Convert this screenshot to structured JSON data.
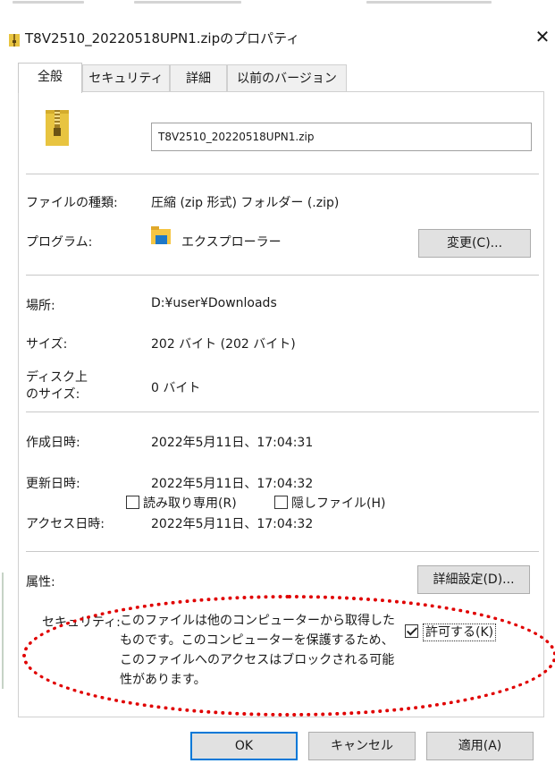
{
  "window": {
    "title": "T8V2510_20220518UPN1.zipのプロパティ",
    "close_symbol": "✕"
  },
  "tabs": [
    "全般",
    "セキュリティ",
    "詳細",
    "以前のバージョン"
  ],
  "file": {
    "name": "T8V2510_20220518UPN1.zip"
  },
  "type_row": {
    "label": "ファイルの種類:",
    "value": "圧縮 (zip 形式) フォルダー (.zip)"
  },
  "program_row": {
    "label": "プログラム:",
    "value": "エクスプローラー",
    "change_button": "変更(C)..."
  },
  "location_row": {
    "label": "場所:",
    "value": "D:¥user¥Downloads"
  },
  "size_row": {
    "label": "サイズ:",
    "value": "202 バイト (202 バイト)"
  },
  "disk_size_row": {
    "label": "ディスク上\nのサイズ:",
    "value": "0 バイト"
  },
  "created_row": {
    "label": "作成日時:",
    "value": "2022年5月11日、17:04:31"
  },
  "modified_row": {
    "label": "更新日時:",
    "value": "2022年5月11日、17:04:32"
  },
  "accessed_row": {
    "label": "アクセス日時:",
    "value": "2022年5月11日、17:04:32"
  },
  "attributes": {
    "label": "属性:",
    "readonly": {
      "label": "読み取り専用(R)",
      "checked": false
    },
    "hidden": {
      "label": "隠しファイル(H)",
      "checked": false
    },
    "advanced_button": "詳細設定(D)..."
  },
  "security": {
    "label": "セキュリティ:",
    "message": "このファイルは他のコンピューターから取得したものです。このコンピューターを保護するため、このファイルへのアクセスはブロックされる可能性があります。",
    "allow": {
      "label": "許可する(K)",
      "checked": true
    }
  },
  "buttons": {
    "ok": "OK",
    "cancel": "キャンセル",
    "apply": "適用(A)"
  },
  "colors": {
    "accent": "#0078d7",
    "annotation": "#e00000",
    "zip_yellow": "#e8c440"
  }
}
